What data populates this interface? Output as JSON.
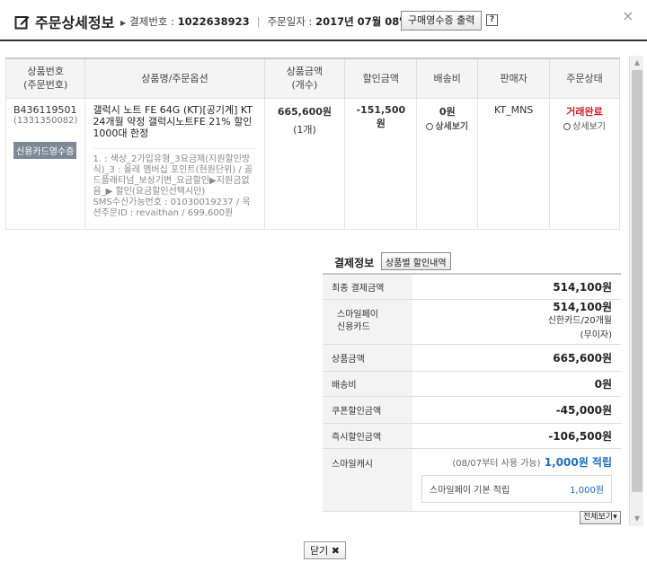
{
  "header": {
    "title": "주문상세정보",
    "payment_no_label": "결제번호 : ",
    "payment_no": "1022638923",
    "order_date_label": "주문일자 : ",
    "order_date": "2017년 07월 08일",
    "receipt_button": "구매영수증 출력",
    "help": "?",
    "close": "×"
  },
  "order_table": {
    "headers": {
      "product_no": "상품번호",
      "order_no": "(주문번호)",
      "name": "상품명/주문옵션",
      "price": "상품금액",
      "qty": "(개수)",
      "discount": "할인금액",
      "shipping": "배송비",
      "seller": "판매자",
      "status": "주문상태"
    },
    "row": {
      "product_no": "B436119501",
      "order_no": "(1331350082)",
      "card_receipt": "신용카드영수증",
      "name": "갤럭시 노트 FE 64G (KT)[공기계] KT 24개월 약정 갤럭시노트FE 21% 할인 1000대 한정",
      "option": "1. : 색상_2가입유형_3요금제(지원할인방식)_3 : 올레 멤버십 포인트(현원단위) / 골드플래티넘_보상기변_요금할인▶지원금없음_▶ 할인(요금할인선택시만)",
      "sms": "SMS수신가능번호 : 01030019237 / 옥션주문ID : revaithan / 699,600원",
      "price": "665,600원",
      "qty": "(1개)",
      "discount": "-151,500원",
      "shipping": "0원",
      "seller": "KT_MNS",
      "status": "거래완료",
      "detail_link": "상세보기"
    }
  },
  "payment": {
    "title": "결제정보",
    "discount_button": "상품별 할인내역",
    "final_label": "최종 결제금액",
    "final_value": "514,100원",
    "method_labels": [
      "스마일페이",
      "신용카드"
    ],
    "method_value": "514,100원",
    "method_sub": [
      "신한카드/20개월",
      "(무이자)"
    ],
    "product_label": "상품금액",
    "product_value": "665,600원",
    "shipping_label": "배송비",
    "shipping_value": "0원",
    "coupon_label": "쿠폰할인금액",
    "coupon_value": "-45,000원",
    "instant_label": "즉시할인금액",
    "instant_value": "-106,500원",
    "cash_label": "스마일캐시",
    "cash_note": "(08/07부터 사용 가능)",
    "cash_value": "1,000원 적립",
    "cash_box_label": "스마일페이 기본 적립",
    "cash_box_value": "1,000원"
  },
  "footer": {
    "view_all": "전체보기▾",
    "close_button": "닫기"
  },
  "colors": {
    "accent_red": "#c0221e",
    "accent_blue": "#1b6dbf",
    "badge_gray": "#7d8a96"
  }
}
